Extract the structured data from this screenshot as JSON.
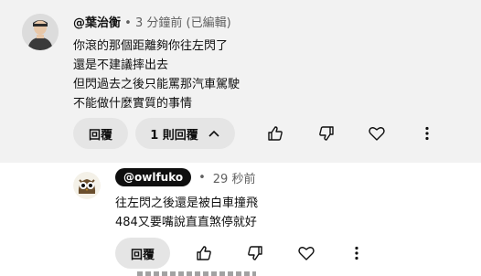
{
  "comment": {
    "author": "@葉治衡",
    "separator": "•",
    "time": "3 分鐘前 (已編輯)",
    "lines": [
      "你滾的那個距離夠你往左閃了",
      "還是不建議摔出去",
      "但閃過去之後只能罵那汽車駕駛",
      "不能做什麼實質的事情"
    ],
    "reply_button": "回覆",
    "replies_toggle": "1 則回覆",
    "icons": [
      "like-icon",
      "dislike-icon",
      "heart-icon",
      "more-vert-icon"
    ]
  },
  "reply": {
    "author": "@owlfuko",
    "separator": "•",
    "time": "29 秒前",
    "lines": [
      "往左閃之後還是被白車撞飛",
      "484又要嘴說直直煞停就好"
    ],
    "reply_button": "回覆",
    "icons": [
      "like-icon",
      "dislike-icon",
      "heart-icon",
      "more-vert-icon"
    ]
  },
  "colors": {
    "thread_bg": "#f2f2f2",
    "pill_bg": "#e5e5e5",
    "badge_bg": "#0f0f0f",
    "text": "#0f0f0f",
    "dim": "#606060"
  }
}
